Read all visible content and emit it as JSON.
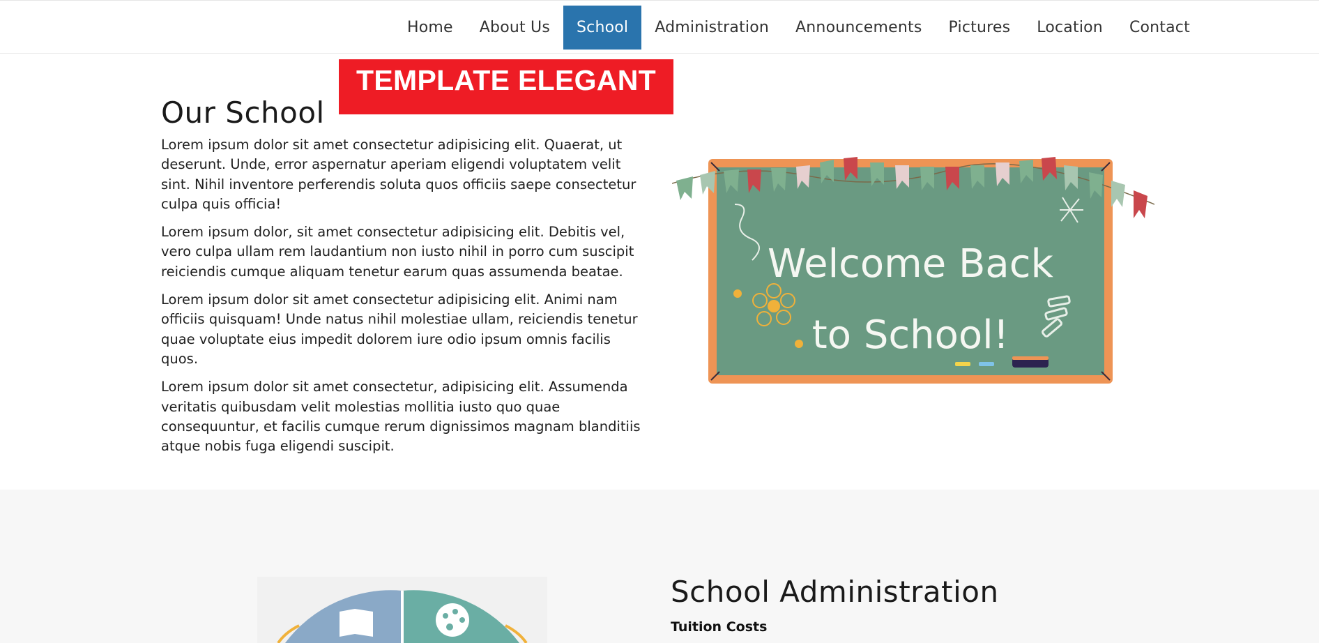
{
  "nav": {
    "items": [
      {
        "label": "Home"
      },
      {
        "label": "About Us"
      },
      {
        "label": "School",
        "active": true
      },
      {
        "label": "Administration"
      },
      {
        "label": "Announcements"
      },
      {
        "label": "Pictures"
      },
      {
        "label": "Location"
      },
      {
        "label": "Contact"
      }
    ],
    "active_color": "#2a74ad"
  },
  "banner": {
    "text": "TEMPLATE ELEGANT",
    "color": "#ee1c25"
  },
  "school": {
    "title": "Our School",
    "paragraphs": [
      "Lorem ipsum dolor sit amet consectetur adipisicing elit. Quaerat, ut deserunt. Unde, error aspernatur aperiam eligendi voluptatem velit sint. Nihil inventore perferendis soluta quos officiis saepe consectetur culpa quis officia!",
      "Lorem ipsum dolor, sit amet consectetur adipisicing elit. Debitis vel, vero culpa ullam rem laudantium non iusto nihil in porro cum suscipit reiciendis cumque aliquam tenetur earum quas assumenda beatae.",
      "Lorem ipsum dolor sit amet consectetur adipisicing elit. Animi nam officiis quisquam! Unde natus nihil molestiae ullam, reiciendis tenetur quae voluptate eius impedit dolorem iure odio ipsum omnis facilis quos.",
      "Lorem ipsum dolor sit amet consectetur, adipisicing elit. Assumenda veritatis quibusdam velit molestias mollitia iusto quo quae consequuntur, et facilis cumque rerum dignissimos magnam blanditiis atque nobis fuga eligendi suscipit."
    ],
    "image": {
      "line1": "Welcome Back",
      "line2": "to School!",
      "board_color": "#6a9a82",
      "frame_color": "#ee9455"
    }
  },
  "admin": {
    "title": "School Administration",
    "subtitle": "Tuition Costs"
  }
}
